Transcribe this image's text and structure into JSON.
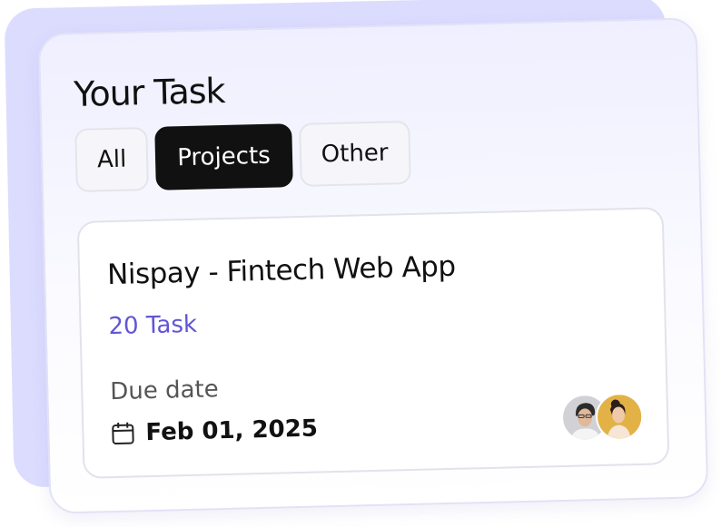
{
  "widget": {
    "title": "Your Task",
    "tabs": [
      {
        "label": "All",
        "active": false
      },
      {
        "label": "Projects",
        "active": true
      },
      {
        "label": "Other",
        "active": false
      }
    ],
    "project": {
      "name": "Nispay - Fintech Web App",
      "task_count": "20 Task",
      "due_label": "Due date",
      "due_date": "Feb 01, 2025",
      "calendar_icon": "calendar-icon",
      "members": [
        {
          "icon": "avatar-man"
        },
        {
          "icon": "avatar-woman"
        }
      ]
    }
  },
  "colors": {
    "accent": "#6155d6",
    "active_tab_bg": "#111111",
    "back_card": "#dcdcff",
    "card_border": "#e2e2f6"
  }
}
